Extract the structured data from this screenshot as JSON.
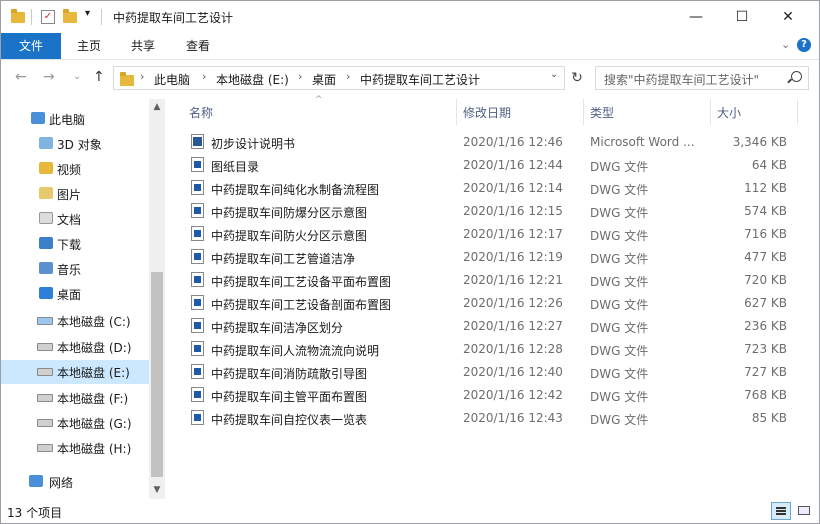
{
  "window": {
    "title": "中药提取车间工艺设计",
    "qa_dropdown": "▾",
    "minimize": "—",
    "maximize": "☐",
    "close": "✕"
  },
  "ribbon": {
    "tabs": [
      "文件",
      "主页",
      "共享",
      "查看"
    ],
    "collapse": "⌄",
    "help": "?"
  },
  "nav_buttons": {
    "back": "←",
    "forward": "→",
    "recent": "⌄",
    "up": "↑"
  },
  "address": {
    "crumbs": [
      "此电脑",
      "本地磁盘 (E:)",
      "桌面",
      "中药提取车间工艺设计"
    ],
    "separator": "›",
    "dropdown": "⌄",
    "refresh": "↻"
  },
  "search": {
    "placeholder": "搜索\"中药提取车间工艺设计\""
  },
  "nav_pane": {
    "items": [
      {
        "label": "此电脑",
        "icon": "computer-icon"
      },
      {
        "label": "3D 对象",
        "icon": "3d-objects-icon"
      },
      {
        "label": "视频",
        "icon": "videos-icon"
      },
      {
        "label": "图片",
        "icon": "pictures-icon"
      },
      {
        "label": "文档",
        "icon": "documents-icon"
      },
      {
        "label": "下载",
        "icon": "downloads-icon"
      },
      {
        "label": "音乐",
        "icon": "music-icon"
      },
      {
        "label": "桌面",
        "icon": "desktop-icon"
      },
      {
        "label": "本地磁盘 (C:)",
        "icon": "system-drive-icon"
      },
      {
        "label": "本地磁盘 (D:)",
        "icon": "drive-icon"
      },
      {
        "label": "本地磁盘 (E:)",
        "icon": "drive-icon",
        "selected": true
      },
      {
        "label": "本地磁盘 (F:)",
        "icon": "drive-icon"
      },
      {
        "label": "本地磁盘 (G:)",
        "icon": "drive-icon"
      },
      {
        "label": "本地磁盘 (H:)",
        "icon": "drive-icon"
      },
      {
        "label": "网络",
        "icon": "network-icon"
      }
    ],
    "scroll_up": "▲",
    "scroll_down": "▼"
  },
  "columns": {
    "name": "名称",
    "date": "修改日期",
    "type": "类型",
    "size": "大小",
    "sort_indicator": "^"
  },
  "files": [
    {
      "name": "初步设计说明书",
      "date": "2020/1/16 12:46",
      "type": "Microsoft Word ...",
      "size": "3,346 KB",
      "icon": "word-document-icon"
    },
    {
      "name": "图纸目录",
      "date": "2020/1/16 12:44",
      "type": "DWG 文件",
      "size": "64 KB",
      "icon": "dwg-file-icon"
    },
    {
      "name": "中药提取车间纯化水制备流程图",
      "date": "2020/1/16 12:14",
      "type": "DWG 文件",
      "size": "112 KB",
      "icon": "dwg-file-icon"
    },
    {
      "name": "中药提取车间防爆分区示意图",
      "date": "2020/1/16 12:15",
      "type": "DWG 文件",
      "size": "574 KB",
      "icon": "dwg-file-icon"
    },
    {
      "name": "中药提取车间防火分区示意图",
      "date": "2020/1/16 12:17",
      "type": "DWG 文件",
      "size": "716 KB",
      "icon": "dwg-file-icon"
    },
    {
      "name": "中药提取车间工艺管道洁净",
      "date": "2020/1/16 12:19",
      "type": "DWG 文件",
      "size": "477 KB",
      "icon": "dwg-file-icon"
    },
    {
      "name": "中药提取车间工艺设备平面布置图",
      "date": "2020/1/16 12:21",
      "type": "DWG 文件",
      "size": "720 KB",
      "icon": "dwg-file-icon"
    },
    {
      "name": "中药提取车间工艺设备剖面布置图",
      "date": "2020/1/16 12:26",
      "type": "DWG 文件",
      "size": "627 KB",
      "icon": "dwg-file-icon"
    },
    {
      "name": "中药提取车间洁净区划分",
      "date": "2020/1/16 12:27",
      "type": "DWG 文件",
      "size": "236 KB",
      "icon": "dwg-file-icon"
    },
    {
      "name": "中药提取车间人流物流流向说明",
      "date": "2020/1/16 12:28",
      "type": "DWG 文件",
      "size": "723 KB",
      "icon": "dwg-file-icon"
    },
    {
      "name": "中药提取车间消防疏散引导图",
      "date": "2020/1/16 12:40",
      "type": "DWG 文件",
      "size": "727 KB",
      "icon": "dwg-file-icon"
    },
    {
      "name": "中药提取车间主管平面布置图",
      "date": "2020/1/16 12:42",
      "type": "DWG 文件",
      "size": "768 KB",
      "icon": "dwg-file-icon"
    },
    {
      "name": "中药提取车间自控仪表一览表",
      "date": "2020/1/16 12:43",
      "type": "DWG 文件",
      "size": "85 KB",
      "icon": "dwg-file-icon"
    }
  ],
  "status": {
    "count": "13 个项目"
  },
  "colors": {
    "accent": "#1a73c7",
    "selected": "#cce8ff",
    "header_text": "#4d6082"
  }
}
